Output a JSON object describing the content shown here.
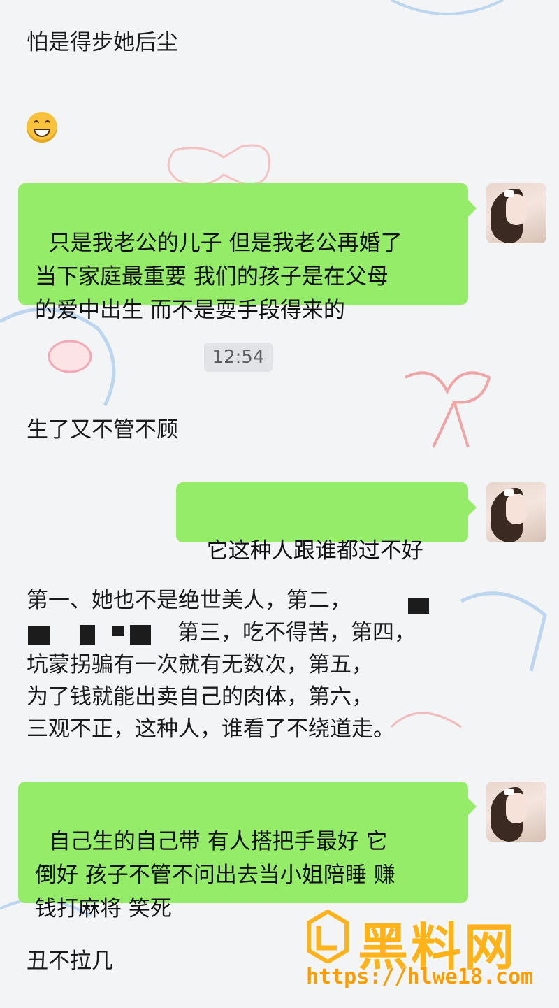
{
  "messages": {
    "m1": "怕是得步她后尘",
    "m2_emoji": "grinning-face-emoji",
    "m3": "只是我老公的儿子 但是我老公再婚了\n当下家庭最重要 我们的孩子是在父母\n的爱中出生 而不是耍手段得来的",
    "timestamp": "12:54",
    "m4": "生了又不管不顾",
    "m5": "它这种人跟谁都过不好",
    "m6_part1": "第一、她也不是绝世美人，第二，",
    "m6_part2": "第三，吃不得苦，第四，",
    "m6_part3": "坑蒙拐骗有一次就有无数次，第五，\n为了钱就能出卖自己的肉体，第六，\n三观不正，这种人，谁看了不绕道走。",
    "m7": "自己生的自己带 有人搭把手最好 它\n倒好 孩子不管不问出去当小姐陪睡 赚\n钱打麻将 笑死",
    "m8": "丑不拉几"
  },
  "watermark": {
    "title": "黑料网",
    "url": "https://hlwe18.com"
  },
  "colors": {
    "green_bubble": "#95ec69",
    "background": "#f3f4f6",
    "watermark": "#ffb21a"
  }
}
